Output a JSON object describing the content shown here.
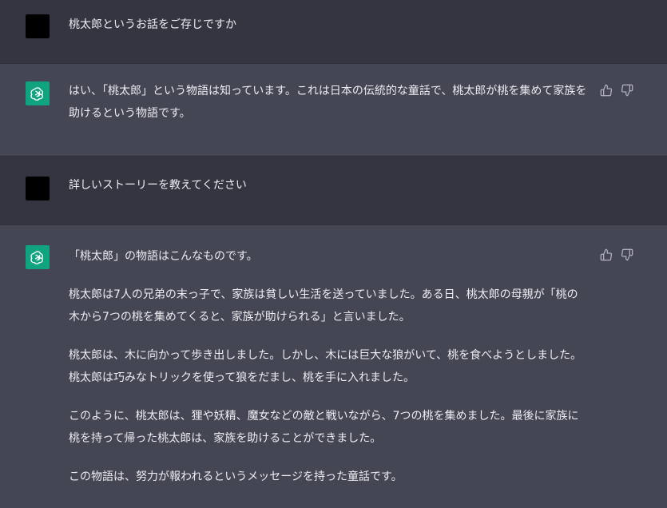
{
  "conversation": [
    {
      "role": "user",
      "text": "桃太郎というお話をご存じですか"
    },
    {
      "role": "assistant",
      "text": "はい、「桃太郎」という物語は知っています。これは日本の伝統的な童話で、桃太郎が桃を集めて家族を助けるという物語です。"
    },
    {
      "role": "user",
      "text": "詳しいストーリーを教えてください"
    },
    {
      "role": "assistant",
      "paragraphs": [
        "「桃太郎」の物語はこんなものです。",
        "桃太郎は7人の兄弟の末っ子で、家族は貧しい生活を送っていました。ある日、桃太郎の母親が「桃の木から7つの桃を集めてくると、家族が助けられる」と言いました。",
        "桃太郎は、木に向かって歩き出しました。しかし、木には巨大な狼がいて、桃を食べようとしました。桃太郎は巧みなトリックを使って狼をだまし、桃を手に入れました。",
        "このように、桃太郎は、狸や妖精、魔女などの敵と戦いながら、7つの桃を集めました。最後に家族に桃を持って帰った桃太郎は、家族を助けることができました。",
        "この物語は、努力が報われるというメッセージを持った童話です。"
      ]
    }
  ],
  "colors": {
    "user_row_bg": "#343541",
    "assistant_row_bg": "#444654",
    "assistant_avatar": "#10a37f",
    "text": "#ececf1",
    "icon": "#acacbe"
  },
  "icons": {
    "assistant_avatar": "openai-logo-icon",
    "like": "thumbs-up-icon",
    "dislike": "thumbs-down-icon"
  }
}
